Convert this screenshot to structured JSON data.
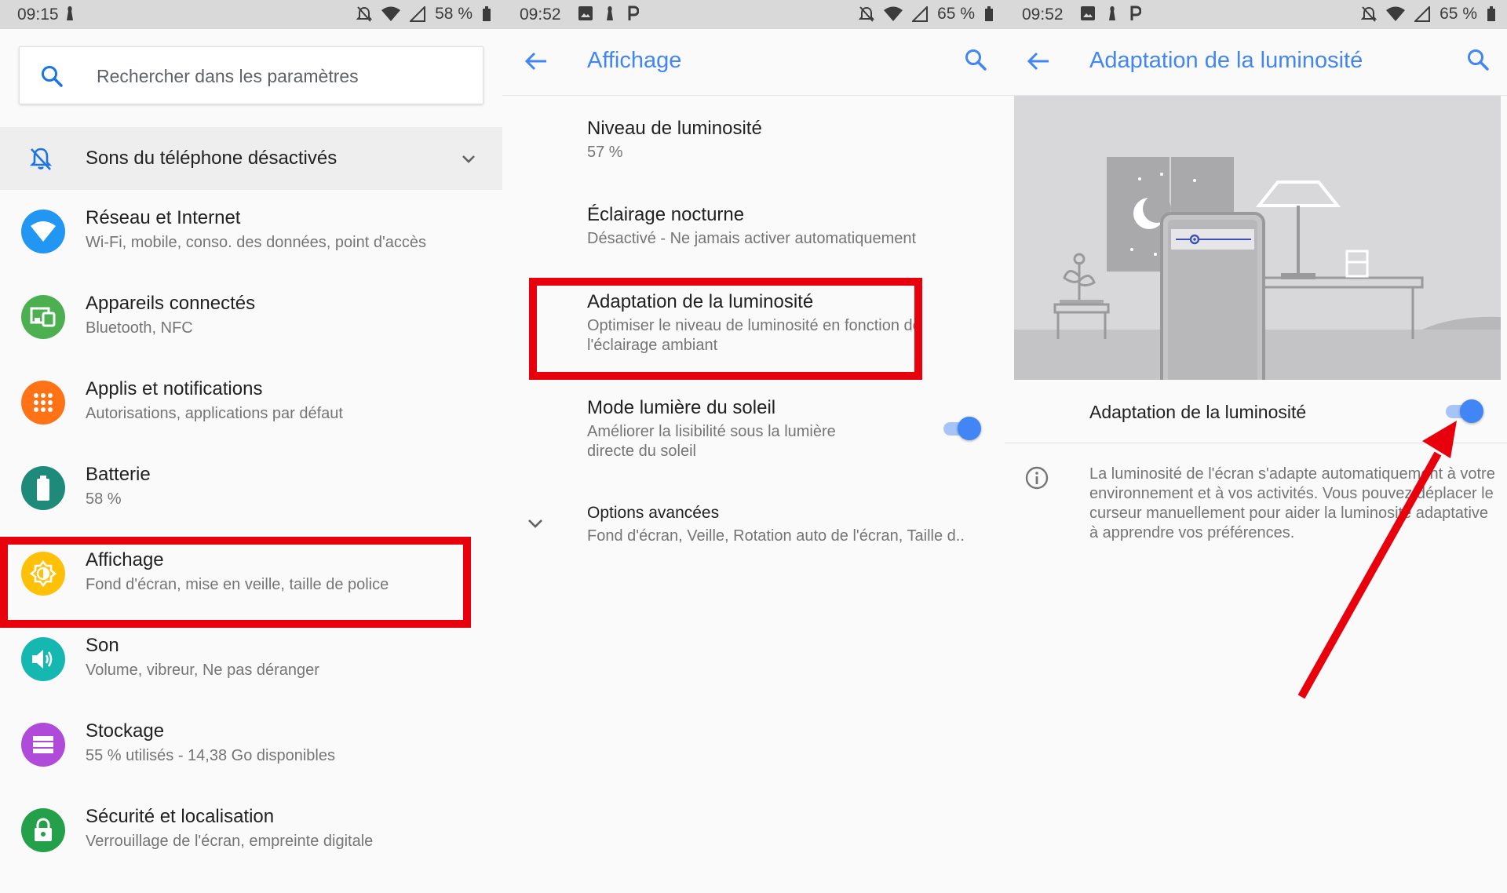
{
  "colors": {
    "accent": "#4285f4",
    "highlight_red": "#e8000d"
  },
  "panel1": {
    "status": {
      "time": "09:15",
      "battery": "58 %"
    },
    "search": {
      "placeholder": "Rechercher dans les paramètres",
      "icon": "search-icon"
    },
    "condition": {
      "label": "Sons du téléphone désactivés",
      "icon": "bell-off-icon"
    },
    "items": [
      {
        "title": "Réseau et Internet",
        "subtitle": "Wi-Fi, mobile, conso. des données, point d'accès",
        "icon": "wifi-icon",
        "color": "#2196f3"
      },
      {
        "title": "Appareils connectés",
        "subtitle": "Bluetooth, NFC",
        "icon": "devices-icon",
        "color": "#4caf50"
      },
      {
        "title": "Applis et notifications",
        "subtitle": "Autorisations, applications par défaut",
        "icon": "apps-icon",
        "color": "#ff7316"
      },
      {
        "title": "Batterie",
        "subtitle": "58 %",
        "icon": "battery-icon",
        "color": "#1e8a7a"
      },
      {
        "title": "Affichage",
        "subtitle": "Fond d'écran, mise en veille, taille de police",
        "icon": "brightness-icon",
        "color": "#ffc107"
      },
      {
        "title": "Son",
        "subtitle": "Volume, vibreur, Ne pas déranger",
        "icon": "volume-icon",
        "color": "#14b8b0"
      },
      {
        "title": "Stockage",
        "subtitle": "55 % utilisés - 14,38 Go disponibles",
        "icon": "storage-icon",
        "color": "#b04ad8"
      },
      {
        "title": "Sécurité et localisation",
        "subtitle": "Verrouillage de l'écran, empreinte digitale",
        "icon": "lock-icon",
        "color": "#25a04a"
      }
    ]
  },
  "panel2": {
    "status": {
      "time": "09:52",
      "battery": "65 %"
    },
    "toolbar": {
      "title": "Affichage"
    },
    "prefs": {
      "brightness_level": {
        "title": "Niveau de luminosité",
        "subtitle": "57 %"
      },
      "night_light": {
        "title": "Éclairage nocturne",
        "subtitle": "Désactivé - Ne jamais activer automatiquement"
      },
      "adaptive": {
        "title": "Adaptation de la luminosité",
        "subtitle": "Optimiser le niveau de luminosité en fonction de l'éclairage ambiant"
      },
      "sunlight": {
        "title": "Mode lumière du soleil",
        "subtitle": "Améliorer la lisibilité sous la lumière directe du soleil",
        "enabled": true
      },
      "advanced": {
        "title": "Options avancées",
        "subtitle": "Fond d'écran, Veille, Rotation auto de l'écran, Taille d.."
      }
    }
  },
  "panel3": {
    "status": {
      "time": "09:52",
      "battery": "65 %"
    },
    "toolbar": {
      "title": "Adaptation de la luminosité"
    },
    "switch": {
      "label": "Adaptation de la luminosité",
      "enabled": true
    },
    "info": "La luminosité de l'écran s'adapte automatiquement à votre environnement et à vos activités. Vous pouvez déplacer le curseur manuellement pour aider la luminosité adaptative à apprendre vos préférences."
  }
}
